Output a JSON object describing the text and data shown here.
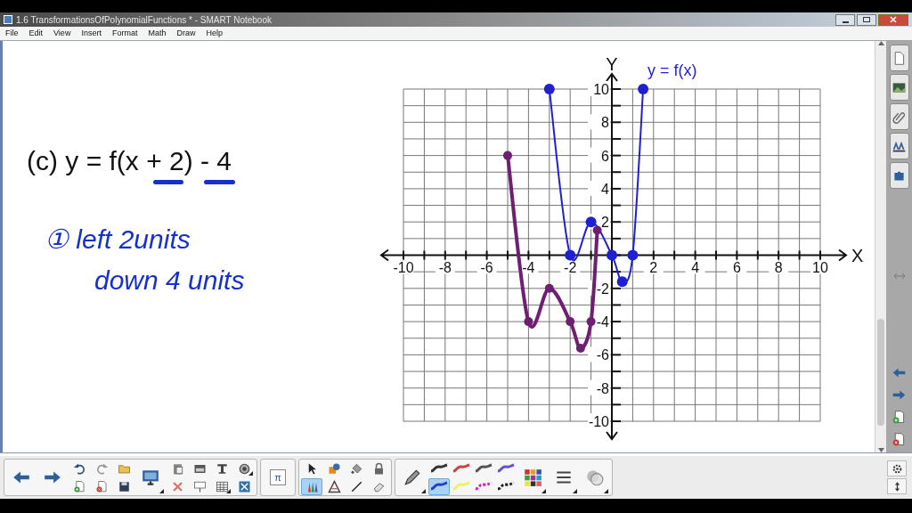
{
  "window": {
    "title": "1.6 TransformationsOfPolynomialFunctions * - SMART Notebook"
  },
  "menu": [
    "File",
    "Edit",
    "View",
    "Insert",
    "Format",
    "Math",
    "Draw",
    "Help"
  ],
  "page": {
    "equation": "(c)  y = f(x + 2) - 4",
    "handwriting": [
      "① left 2units",
      "down 4 units"
    ],
    "chart_data": {
      "type": "line",
      "xlabel": "X",
      "ylabel": "Y",
      "x": [
        -5,
        -4,
        -3,
        -2,
        -1.5,
        -1,
        -0.7,
        0,
        0.5,
        1,
        1.5
      ],
      "series": [
        {
          "name": "y = f(x)",
          "color": "#1f1fd6",
          "marker": true,
          "values": [
            null,
            null,
            10,
            0,
            null,
            2,
            null,
            0,
            -1.6,
            0,
            10
          ]
        },
        {
          "color": "#6e1f72",
          "marker": true,
          "values": [
            6,
            -4,
            -2,
            -4,
            -5.6,
            -4,
            1.5,
            null,
            null,
            null,
            null
          ]
        }
      ],
      "xlim": [
        -10,
        10
      ],
      "ylim": [
        -10,
        10
      ],
      "grid": true,
      "xticks": [
        -10,
        -8,
        -6,
        -4,
        -2,
        2,
        4,
        6,
        8,
        10
      ],
      "yticks": [
        10,
        8,
        6,
        4,
        2,
        -2,
        -4,
        -6,
        -8,
        -10
      ]
    }
  },
  "sidebar": [
    {
      "kind": "page"
    },
    {
      "kind": "picture"
    },
    {
      "kind": "attach"
    },
    {
      "kind": "properties"
    },
    {
      "kind": "addon"
    }
  ],
  "sidebar_bottom": [
    {
      "kind": "back"
    },
    {
      "kind": "forward"
    },
    {
      "kind": "add-page"
    },
    {
      "kind": "delete-page"
    }
  ],
  "toolbar": [
    {
      "columns": [
        [
          {
            "kind": "back",
            "selected": false,
            "dropdown": false
          }
        ],
        [
          {
            "kind": "forward",
            "selected": false,
            "dropdown": false
          }
        ],
        [
          {
            "kind": "undo",
            "selected": false,
            "dropdown": false
          },
          {
            "kind": "add-page",
            "selected": false,
            "dropdown": false
          }
        ],
        [
          {
            "kind": "redo",
            "selected": false,
            "dropdown": false
          },
          {
            "kind": "delete-page",
            "selected": false,
            "dropdown": false
          }
        ],
        [
          {
            "kind": "open",
            "selected": false,
            "dropdown": false
          },
          {
            "kind": "save",
            "selected": false,
            "dropdown": false
          }
        ],
        [
          {
            "kind": "display",
            "selected": false,
            "dropdown": true
          }
        ],
        [
          {
            "kind": "paste",
            "selected": false,
            "dropdown": false
          },
          {
            "kind": "delete",
            "selected": false,
            "dropdown": false
          }
        ],
        [
          {
            "kind": "shade",
            "selected": false,
            "dropdown": false
          },
          {
            "kind": "presentation",
            "selected": false,
            "dropdown": false
          }
        ],
        [
          {
            "kind": "text",
            "selected": false,
            "dropdown": false
          },
          {
            "kind": "table",
            "selected": false,
            "dropdown": true
          }
        ],
        [
          {
            "kind": "capture",
            "selected": false,
            "dropdown": true
          },
          {
            "kind": "tools",
            "selected": false,
            "dropdown": false
          }
        ]
      ]
    },
    {
      "columns": [
        [
          {
            "kind": "math",
            "label": "π",
            "selected": false,
            "dropdown": false
          }
        ]
      ]
    },
    {
      "columns": [
        [
          {
            "kind": "select",
            "selected": false,
            "dropdown": false
          },
          {
            "kind": "pens",
            "selected": true,
            "dropdown": false
          }
        ],
        [
          {
            "kind": "shapes",
            "selected": false,
            "dropdown": false
          },
          {
            "kind": "triangle",
            "selected": false,
            "dropdown": false
          }
        ],
        [
          {
            "kind": "fill",
            "selected": false,
            "dropdown": false
          },
          {
            "kind": "line",
            "selected": false,
            "dropdown": false
          }
        ],
        [
          {
            "kind": "lock",
            "selected": false,
            "dropdown": false
          },
          {
            "kind": "eraser",
            "selected": false,
            "dropdown": false
          }
        ]
      ]
    },
    {
      "columns": [
        [
          {
            "kind": "pencil",
            "selected": false,
            "dropdown": true
          }
        ],
        [
          {
            "kind": "stroke",
            "color": "#333333",
            "selected": false,
            "dropdown": false
          },
          {
            "kind": "stroke",
            "color": "#2a3fc0",
            "selected": true,
            "dropdown": false
          }
        ],
        [
          {
            "kind": "stroke",
            "color": "#d04040",
            "selected": false,
            "dropdown": false
          },
          {
            "kind": "stroke",
            "color": "#f0f060",
            "selected": false,
            "dropdown": false
          }
        ],
        [
          {
            "kind": "stroke",
            "color": "#555555",
            "selected": false,
            "dropdown": false
          },
          {
            "kind": "stroke-dashed",
            "color": "#d020c0",
            "selected": false,
            "dropdown": false
          }
        ],
        [
          {
            "kind": "stroke",
            "color": "#6a4fd0",
            "selected": false,
            "dropdown": false
          },
          {
            "kind": "stroke-dashed",
            "color": "#222222",
            "selected": false,
            "dropdown": false
          }
        ],
        [
          {
            "kind": "palette",
            "selected": false,
            "dropdown": true
          }
        ],
        [
          {
            "kind": "line-style",
            "selected": false,
            "dropdown": true
          }
        ],
        [
          {
            "kind": "transparency",
            "selected": false,
            "dropdown": true
          }
        ]
      ]
    }
  ],
  "toolbar_right": [
    {
      "kind": "settings"
    },
    {
      "kind": "move"
    }
  ]
}
